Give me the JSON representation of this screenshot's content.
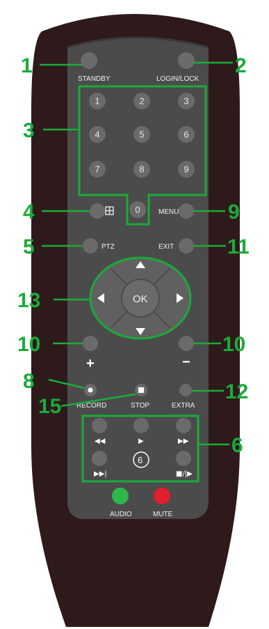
{
  "remote": {
    "labels": {
      "standby": "STANDBY",
      "login_lock": "LOGIN/LOCK",
      "menu": "MENU",
      "ptz": "PTZ",
      "exit": "EXIT",
      "ok": "OK",
      "plus": "+",
      "minus": "−",
      "record": "RECORD",
      "stop": "STOP",
      "extra": "EXTRA",
      "audio": "AUDIO",
      "mute": "MUTE",
      "playback_circle": "6"
    },
    "numpad": [
      "1",
      "2",
      "3",
      "4",
      "5",
      "6",
      "7",
      "8",
      "9",
      "0"
    ],
    "colors": {
      "body": "#2e1a1a",
      "face": "#4b4b4b",
      "button": "#6a6a6a",
      "callout": "#1aab3a",
      "audio": "#2db84a",
      "mute": "#e0202a"
    }
  },
  "callouts": {
    "c1": "1",
    "c2": "2",
    "c3": "3",
    "c4": "4",
    "c5": "5",
    "c6": "6",
    "c8": "8",
    "c9": "9",
    "c10_left": "10",
    "c10_right": "10",
    "c11": "11",
    "c12": "12",
    "c13": "13",
    "c15": "15"
  }
}
